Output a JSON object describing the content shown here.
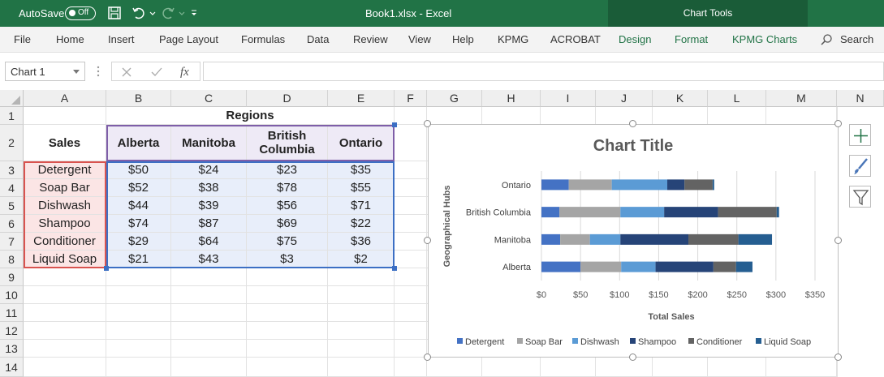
{
  "titlebar": {
    "autosave_label": "AutoSave",
    "autosave_state": "Off",
    "document_title": "Book1.xlsx  -  Excel",
    "contextual_group": "Chart Tools"
  },
  "ribbon": {
    "tabs": [
      "File",
      "Home",
      "Insert",
      "Page Layout",
      "Formulas",
      "Data",
      "Review",
      "View",
      "Help",
      "KPMG",
      "ACROBAT"
    ],
    "context_tabs": [
      "Design",
      "Format",
      "KPMG Charts"
    ],
    "search_label": "Search"
  },
  "formula_bar": {
    "name_box": "Chart 1",
    "fx_label": "fx",
    "formula": ""
  },
  "sheet": {
    "columns": [
      "A",
      "B",
      "C",
      "D",
      "E",
      "F",
      "G",
      "H",
      "I",
      "J",
      "K",
      "L",
      "M",
      "N"
    ],
    "rows": [
      "1",
      "2",
      "3",
      "4",
      "5",
      "6",
      "7",
      "8",
      "9",
      "10",
      "11",
      "12",
      "13",
      "14"
    ],
    "regions_header": "Regions",
    "sales_header": "Sales",
    "region_headers": [
      "Alberta",
      "Manitoba",
      "British Columbia",
      "Ontario"
    ],
    "products": [
      "Detergent",
      "Soap Bar",
      "Dishwash",
      "Shampoo",
      "Conditioner",
      "Liquid Soap"
    ],
    "values": [
      [
        "$50",
        "$24",
        "$23",
        "$35"
      ],
      [
        "$52",
        "$38",
        "$78",
        "$55"
      ],
      [
        "$44",
        "$39",
        "$56",
        "$71"
      ],
      [
        "$74",
        "$87",
        "$69",
        "$22"
      ],
      [
        "$29",
        "$64",
        "$75",
        "$36"
      ],
      [
        "$21",
        "$43",
        "$3",
        "$2"
      ]
    ]
  },
  "chart_data": {
    "type": "bar",
    "stacked": true,
    "orientation": "horizontal",
    "title": "Chart Title",
    "xlabel": "Total Sales",
    "ylabel": "Geographical Hubs",
    "categories": [
      "Alberta",
      "Manitoba",
      "British Columbia",
      "Ontario"
    ],
    "xlim": [
      0,
      350
    ],
    "xticks": [
      "$0",
      "$50",
      "$100",
      "$150",
      "$200",
      "$250",
      "$300",
      "$350"
    ],
    "grid": true,
    "legend": "bottom",
    "series": [
      {
        "name": "Detergent",
        "values": [
          50,
          24,
          23,
          35
        ],
        "color": "#4472c4"
      },
      {
        "name": "Soap Bar",
        "values": [
          52,
          38,
          78,
          55
        ],
        "color": "#a5a5a5"
      },
      {
        "name": "Dishwash",
        "values": [
          44,
          39,
          56,
          71
        ],
        "color": "#5b9bd5"
      },
      {
        "name": "Shampoo",
        "values": [
          74,
          87,
          69,
          22
        ],
        "color": "#264478"
      },
      {
        "name": "Conditioner",
        "values": [
          29,
          64,
          75,
          36
        ],
        "color": "#636363"
      },
      {
        "name": "Liquid Soap",
        "values": [
          21,
          43,
          3,
          2
        ],
        "color": "#255e91"
      }
    ]
  },
  "colors": {
    "excel_green": "#217346",
    "header_fill": "#eeeaf6",
    "label_fill": "#fbe5e5",
    "value_fill": "#e8eefa"
  }
}
